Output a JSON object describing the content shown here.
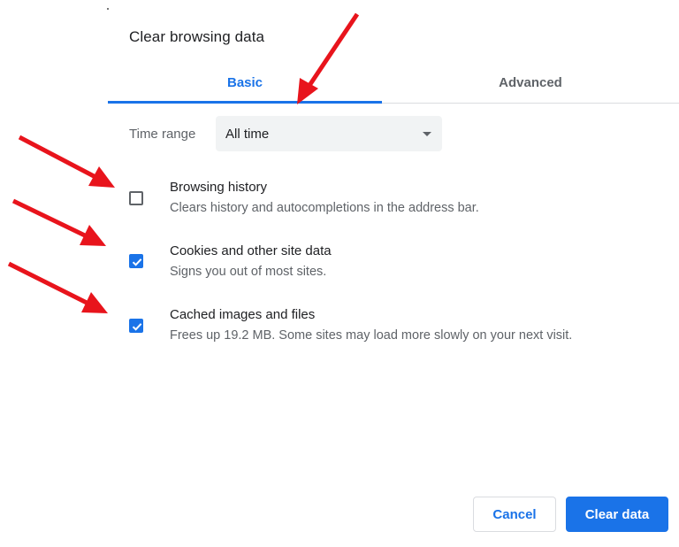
{
  "dialog": {
    "title": "Clear browsing data"
  },
  "tabs": [
    {
      "label": "Basic",
      "active": true
    },
    {
      "label": "Advanced",
      "active": false
    }
  ],
  "time_range": {
    "label": "Time range",
    "value": "All time"
  },
  "options": [
    {
      "label": "Browsing history",
      "description": "Clears history and autocompletions in the address bar.",
      "checked": false
    },
    {
      "label": "Cookies and other site data",
      "description": "Signs you out of most sites.",
      "checked": true
    },
    {
      "label": "Cached images and files",
      "description": "Frees up 19.2 MB. Some sites may load more slowly on your next visit.",
      "checked": true
    }
  ],
  "buttons": {
    "cancel_label": "Cancel",
    "clear_label": "Clear data"
  },
  "colors": {
    "accent": "#1a73e8",
    "annotation_arrow": "#e8141c"
  },
  "icons": {
    "dropdown": "chevron-down-icon",
    "checkmark": "checkmark-icon",
    "annotation": "red-arrow-icon"
  }
}
